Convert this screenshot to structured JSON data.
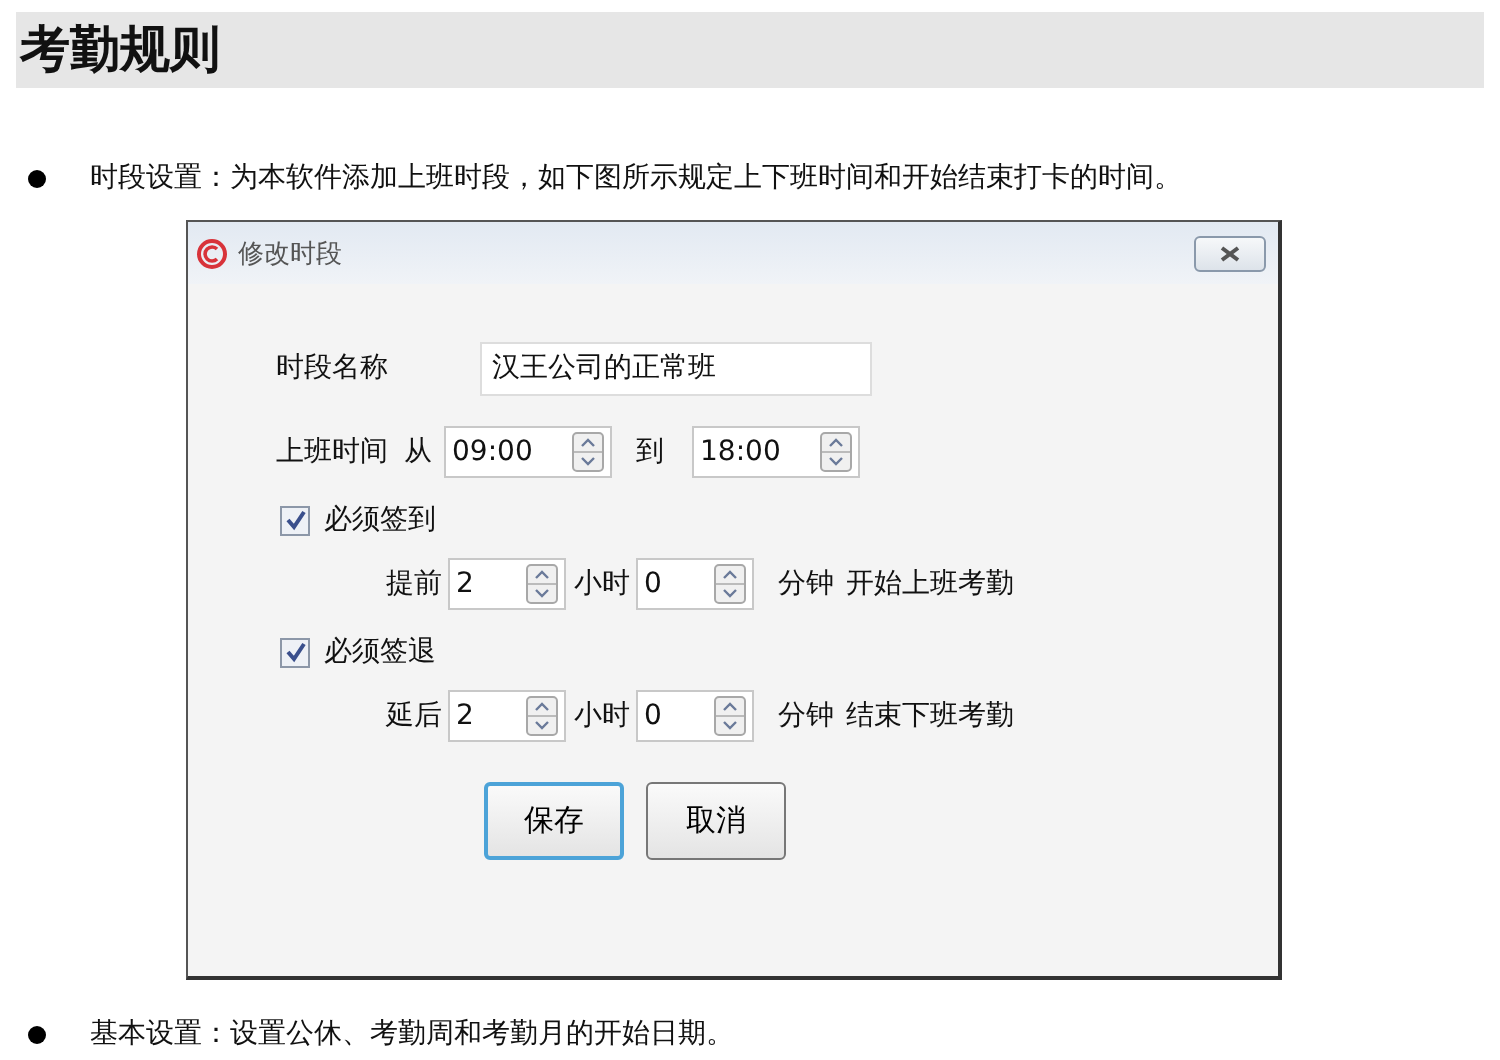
{
  "heading": "考勤规则",
  "bullets": [
    {
      "text": "时段设置：为本软件添加上班时段，如下图所示规定上下班时间和开始结束打卡的时间。"
    }
  ],
  "dialog": {
    "title": "修改时段",
    "name_label": "时段名称",
    "name_value": "汉王公司的正常班",
    "work_time": {
      "label": "上班时间",
      "from": "从",
      "start": "09:00",
      "to": "到",
      "end": "18:00"
    },
    "rules": [
      {
        "label": "必须签到",
        "checked": true,
        "prefix": "提前",
        "hours": "2",
        "hours_unit": "小时",
        "minutes": "0",
        "minutes_unit": "分钟",
        "suffix": "开始上班考勤"
      },
      {
        "label": "必须签退",
        "checked": true,
        "prefix": "延后",
        "hours": "2",
        "hours_unit": "小时",
        "minutes": "0",
        "minutes_unit": "分钟",
        "suffix": "结束下班考勤"
      }
    ],
    "buttons": [
      {
        "label": "保存",
        "default": true
      },
      {
        "label": "取消",
        "default": false
      }
    ]
  },
  "footer_bullets": [
    {
      "text": "基本设置：设置公休、考勤周和考勤月的开始日期。"
    }
  ]
}
